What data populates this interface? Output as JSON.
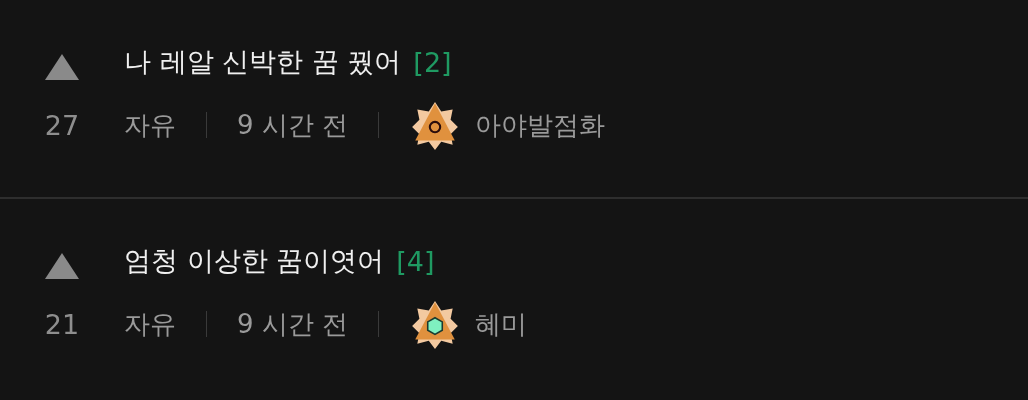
{
  "posts": [
    {
      "title": "나 레알 신박한 꿈 꿨어",
      "comments": "[2]",
      "votes": "27",
      "category": "자유",
      "time": "9 시간 전",
      "author": "아야발점화",
      "badge": {
        "kind": "ring"
      }
    },
    {
      "title": "엄청 이상한 꿈이엿어",
      "comments": "[4]",
      "votes": "21",
      "category": "자유",
      "time": "9 시간 전",
      "author": "혜미",
      "badge": {
        "kind": "gem"
      }
    }
  ]
}
